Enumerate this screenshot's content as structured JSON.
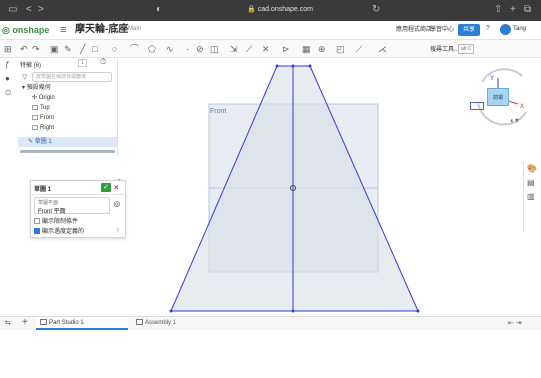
{
  "browser": {
    "nav_back": "<",
    "nav_fwd": ">",
    "sidebar_icon": "▭",
    "privacy_icon": "◐",
    "url": "cad.onshape.com",
    "share_icon": "⇧",
    "add_tab_icon": "+",
    "tabs_icon": "⧉",
    "reload_icon": "↻"
  },
  "header": {
    "logo_text": "onshape",
    "menu_icon": "≡",
    "document_title": "摩天輪-底座",
    "workspace": "Main",
    "app_store": "應用程式商店",
    "learning_center": "學習中心",
    "share_label": "共享",
    "help_icon": "?",
    "user_name": "Tang"
  },
  "toolbar": {
    "search_tools": "搜尋工具...",
    "search_shortcut": "alt C"
  },
  "feature_panel": {
    "title": "特徵 (6)",
    "count_badge": "1",
    "search_placeholder": "按草圖名稱搜尋或篩選",
    "default_geometry": "預設幾何",
    "origin": "Origin",
    "top": "Top",
    "front": "Front",
    "right": "Right",
    "sketch1": "草圖 1"
  },
  "sketch_dialog": {
    "name": "草圖 1",
    "ok_icon": "✓",
    "cancel_icon": "×",
    "plane_label": "草圖平面",
    "plane_value": "Front 平面",
    "show_constraints": "顯示限制條件",
    "show_overdefined": "顯示過度定義的",
    "collapse_icon": "⇤",
    "help_icon": "?"
  },
  "viewport": {
    "plane_label": "Front"
  },
  "view_cube": {
    "face_label": "前視",
    "y_axis": "Y",
    "x_axis": "X"
  },
  "bottom_bar": {
    "tab_part_studio": "Part Studio 1",
    "tab_assembly": "Assembly 1"
  },
  "colors": {
    "accent": "#2a7fd4",
    "sketch_line": "#2f3fd6",
    "plane_fill": "#e7eaf0",
    "plane_stroke": "#b9c8e0",
    "ok_green": "#2e9e3e",
    "cancel_red": "#d0312d"
  }
}
